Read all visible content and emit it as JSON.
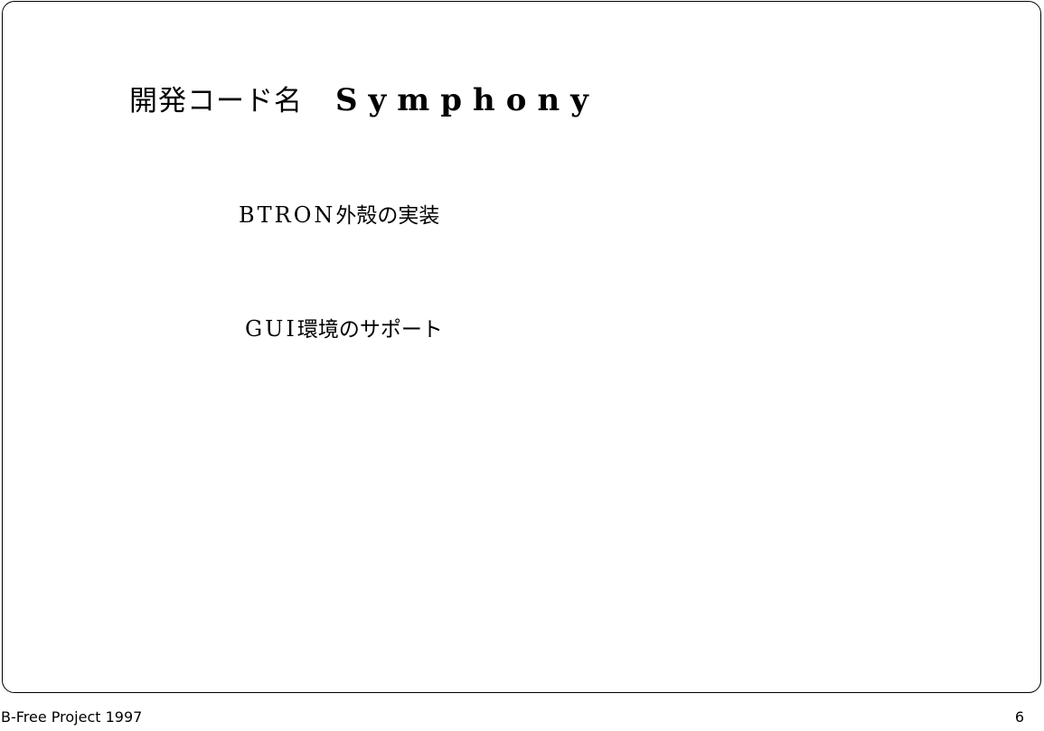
{
  "slide": {
    "title_prefix": "開発コード名",
    "title_name": "Symphony",
    "bullets": [
      {
        "latin": "BTRON",
        "japanese": "外殻の実装"
      },
      {
        "latin": "GUI",
        "japanese": "環境のサポート"
      }
    ]
  },
  "footer": {
    "left": "B-Free Project 1997",
    "page_number": "6"
  }
}
